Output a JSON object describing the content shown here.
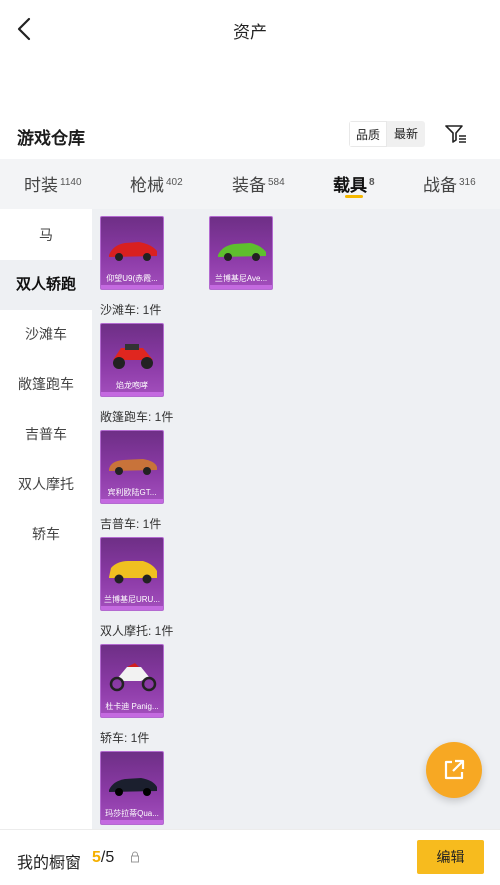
{
  "header": {
    "title": "资产",
    "back_icon": "chevron-left-icon"
  },
  "warehouse": {
    "title": "游戏仓库",
    "sort": [
      {
        "label": "品质",
        "active": true
      },
      {
        "label": "最新",
        "active": false
      }
    ],
    "filter_icon": "filter-icon"
  },
  "tabs": [
    {
      "label": "时装",
      "count": "1140",
      "active": false
    },
    {
      "label": "枪械",
      "count": "402",
      "active": false
    },
    {
      "label": "装备",
      "count": "584",
      "active": false
    },
    {
      "label": "载具",
      "count": "8",
      "active": true
    },
    {
      "label": "战备",
      "count": "316",
      "active": false
    }
  ],
  "sidebar": [
    {
      "label": "马",
      "active": false
    },
    {
      "label": "双人轿跑",
      "active": true
    },
    {
      "label": "沙滩车",
      "active": false
    },
    {
      "label": "敞篷跑车",
      "active": false
    },
    {
      "label": "吉普车",
      "active": false
    },
    {
      "label": "双人摩托",
      "active": false
    },
    {
      "label": "轿车",
      "active": false
    }
  ],
  "sections": [
    {
      "label": "",
      "items": [
        {
          "name": "仰望U9(赤霞...",
          "color": "#d92020"
        },
        {
          "name": "兰博基尼Ave...",
          "color": "#5ebf2e"
        }
      ]
    },
    {
      "label": "沙滩车: 1件",
      "items": [
        {
          "name": "焰龙咆哮",
          "color": "#e0261f"
        }
      ]
    },
    {
      "label": "敞篷跑车: 1件",
      "items": [
        {
          "name": "宾利欧陆GT...",
          "color": "#c8733a"
        }
      ]
    },
    {
      "label": "吉普车: 1件",
      "items": [
        {
          "name": "兰博基尼URU...",
          "color": "#f0c020"
        }
      ]
    },
    {
      "label": "双人摩托: 1件",
      "items": [
        {
          "name": "杜卡迪 Panig...",
          "color": "#f2f2f2"
        }
      ]
    },
    {
      "label": "轿车: 1件",
      "items": [
        {
          "name": "玛莎拉蒂Qua...",
          "color": "#1b1f2e"
        }
      ]
    }
  ],
  "fab": {
    "icon": "share-external-icon"
  },
  "bottom": {
    "window_label": "我的橱窗",
    "current": "5",
    "total": "/5",
    "lock_icon": "lock-icon",
    "edit_label": "编辑"
  },
  "colors": {
    "accent": "#f7bb1e",
    "card_purple": "#8b3aa6"
  }
}
